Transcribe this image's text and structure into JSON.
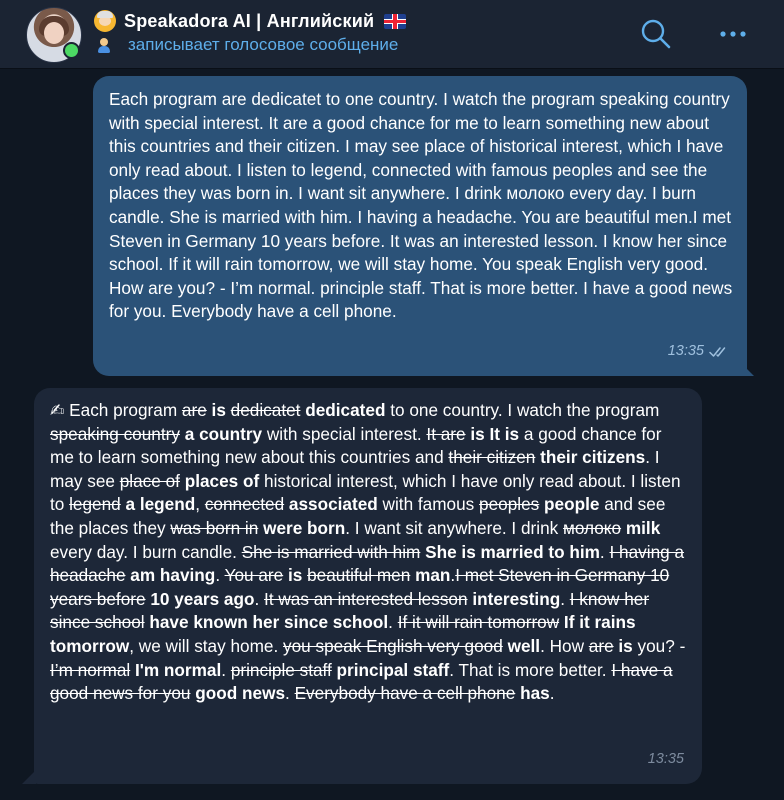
{
  "header": {
    "title": "Speakadora AI | Английский",
    "status": "записывает голосовое сообщение",
    "title_icon": "teacher-emoji-icon",
    "flag_icon": "uk-flag-icon",
    "online": true
  },
  "messages": {
    "outgoing": {
      "text": "Each program are dedicatet to one country. I watch the program speaking country with special interest. It are a good chance for me to learn something new about this countries and their citizen. I may see place of historical interest, which I have only read about. I listen to legend, connected with famous peoples and see the places they was born in. I want sit anywhere. I drink молоко every day. I burn candle. She is married with him. I having a headache. You are beautiful men.I met Steven in Germany 10 years before. It was an interested lesson. I know her since school. If it will rain tomorrow, we will stay home. You speak English very good. How are you? - I’m normal. principle staff. That is more better. I have a good news for you. Everybody have a cell phone.",
      "time": "13:35",
      "status_icon": "double-check-icon"
    },
    "incoming": {
      "icon": "✍",
      "segments": [
        {
          "t": "n",
          "s": " Each program "
        },
        {
          "t": "d",
          "s": "are"
        },
        {
          "t": "n",
          "s": " "
        },
        {
          "t": "i",
          "s": "is"
        },
        {
          "t": "n",
          "s": " "
        },
        {
          "t": "d",
          "s": "dedicatet"
        },
        {
          "t": "n",
          "s": " "
        },
        {
          "t": "i",
          "s": "dedicated"
        },
        {
          "t": "n",
          "s": " to one country. I watch the program "
        },
        {
          "t": "d",
          "s": "speaking country"
        },
        {
          "t": "n",
          "s": " "
        },
        {
          "t": "i",
          "s": "a country"
        },
        {
          "t": "n",
          "s": " with special interest. "
        },
        {
          "t": "d",
          "s": "It are"
        },
        {
          "t": "n",
          "s": " "
        },
        {
          "t": "i",
          "s": "is It is"
        },
        {
          "t": "n",
          "s": " a good chance for me to learn something new about this countries and "
        },
        {
          "t": "d",
          "s": "their citizen"
        },
        {
          "t": "n",
          "s": " "
        },
        {
          "t": "i",
          "s": "their citizens"
        },
        {
          "t": "n",
          "s": ". I may see "
        },
        {
          "t": "d",
          "s": "place of"
        },
        {
          "t": "n",
          "s": " "
        },
        {
          "t": "i",
          "s": "places of"
        },
        {
          "t": "n",
          "s": " historical interest, which I have only read about. I listen to "
        },
        {
          "t": "d",
          "s": "legend"
        },
        {
          "t": "n",
          "s": " "
        },
        {
          "t": "i",
          "s": "a legend"
        },
        {
          "t": "n",
          "s": ", "
        },
        {
          "t": "d",
          "s": "connected"
        },
        {
          "t": "n",
          "s": " "
        },
        {
          "t": "i",
          "s": "associated"
        },
        {
          "t": "n",
          "s": " with famous "
        },
        {
          "t": "d",
          "s": "peoples"
        },
        {
          "t": "n",
          "s": " "
        },
        {
          "t": "i",
          "s": "people"
        },
        {
          "t": "n",
          "s": " and see the places they "
        },
        {
          "t": "d",
          "s": "was born in"
        },
        {
          "t": "n",
          "s": " "
        },
        {
          "t": "i",
          "s": "were born"
        },
        {
          "t": "n",
          "s": ". I want sit anywhere. I drink "
        },
        {
          "t": "d",
          "s": "молоко"
        },
        {
          "t": "n",
          "s": " "
        },
        {
          "t": "i",
          "s": "milk"
        },
        {
          "t": "n",
          "s": " every day. I burn candle. "
        },
        {
          "t": "d",
          "s": "She is married with him"
        },
        {
          "t": "n",
          "s": " "
        },
        {
          "t": "i",
          "s": "She is married to him"
        },
        {
          "t": "n",
          "s": ". "
        },
        {
          "t": "d",
          "s": "I having a headache"
        },
        {
          "t": "n",
          "s": " "
        },
        {
          "t": "i",
          "s": "am having"
        },
        {
          "t": "n",
          "s": ". "
        },
        {
          "t": "d",
          "s": "You are"
        },
        {
          "t": "n",
          "s": " "
        },
        {
          "t": "i",
          "s": "is"
        },
        {
          "t": "n",
          "s": " "
        },
        {
          "t": "d",
          "s": "beautiful men"
        },
        {
          "t": "n",
          "s": " "
        },
        {
          "t": "i",
          "s": "man"
        },
        {
          "t": "n",
          "s": "."
        },
        {
          "t": "d",
          "s": "I met Steven in Germany 10 years before"
        },
        {
          "t": "n",
          "s": " "
        },
        {
          "t": "i",
          "s": "10 years ago"
        },
        {
          "t": "n",
          "s": ". "
        },
        {
          "t": "d",
          "s": "It was an interested lesson"
        },
        {
          "t": "n",
          "s": " "
        },
        {
          "t": "i",
          "s": "interesting"
        },
        {
          "t": "n",
          "s": ". "
        },
        {
          "t": "d",
          "s": "I know her since school"
        },
        {
          "t": "n",
          "s": " "
        },
        {
          "t": "i",
          "s": "have known her since school"
        },
        {
          "t": "n",
          "s": ". "
        },
        {
          "t": "d",
          "s": "If it will rain tomorrow"
        },
        {
          "t": "n",
          "s": " "
        },
        {
          "t": "i",
          "s": "If it rains tomorrow"
        },
        {
          "t": "n",
          "s": ", we will stay home. "
        },
        {
          "t": "d",
          "s": "you speak English very good"
        },
        {
          "t": "n",
          "s": " "
        },
        {
          "t": "i",
          "s": "well"
        },
        {
          "t": "n",
          "s": ". How "
        },
        {
          "t": "d",
          "s": "are"
        },
        {
          "t": "n",
          "s": " "
        },
        {
          "t": "i",
          "s": "is"
        },
        {
          "t": "n",
          "s": " you? - "
        },
        {
          "t": "d",
          "s": "I’m normal"
        },
        {
          "t": "n",
          "s": " "
        },
        {
          "t": "i",
          "s": "I'm normal"
        },
        {
          "t": "n",
          "s": ". "
        },
        {
          "t": "d",
          "s": "principle staff"
        },
        {
          "t": "n",
          "s": " "
        },
        {
          "t": "i",
          "s": "principal staff"
        },
        {
          "t": "n",
          "s": ". That is more better. "
        },
        {
          "t": "d",
          "s": "I have a good news for you"
        },
        {
          "t": "n",
          "s": " "
        },
        {
          "t": "i",
          "s": "good news"
        },
        {
          "t": "n",
          "s": ". "
        },
        {
          "t": "d",
          "s": "Everybody have a cell phone"
        },
        {
          "t": "n",
          "s": " "
        },
        {
          "t": "i",
          "s": "has"
        },
        {
          "t": "n",
          "s": "."
        }
      ],
      "time": "13:35"
    }
  },
  "colors": {
    "background": "#0f1722",
    "header": "#1b2433",
    "outgoing_bubble": "#2b5278",
    "incoming_bubble": "#1d2738",
    "accent": "#5eaeea",
    "online": "#4cd964"
  },
  "icons": {
    "search": "search-icon",
    "more": "more-dots-icon"
  }
}
